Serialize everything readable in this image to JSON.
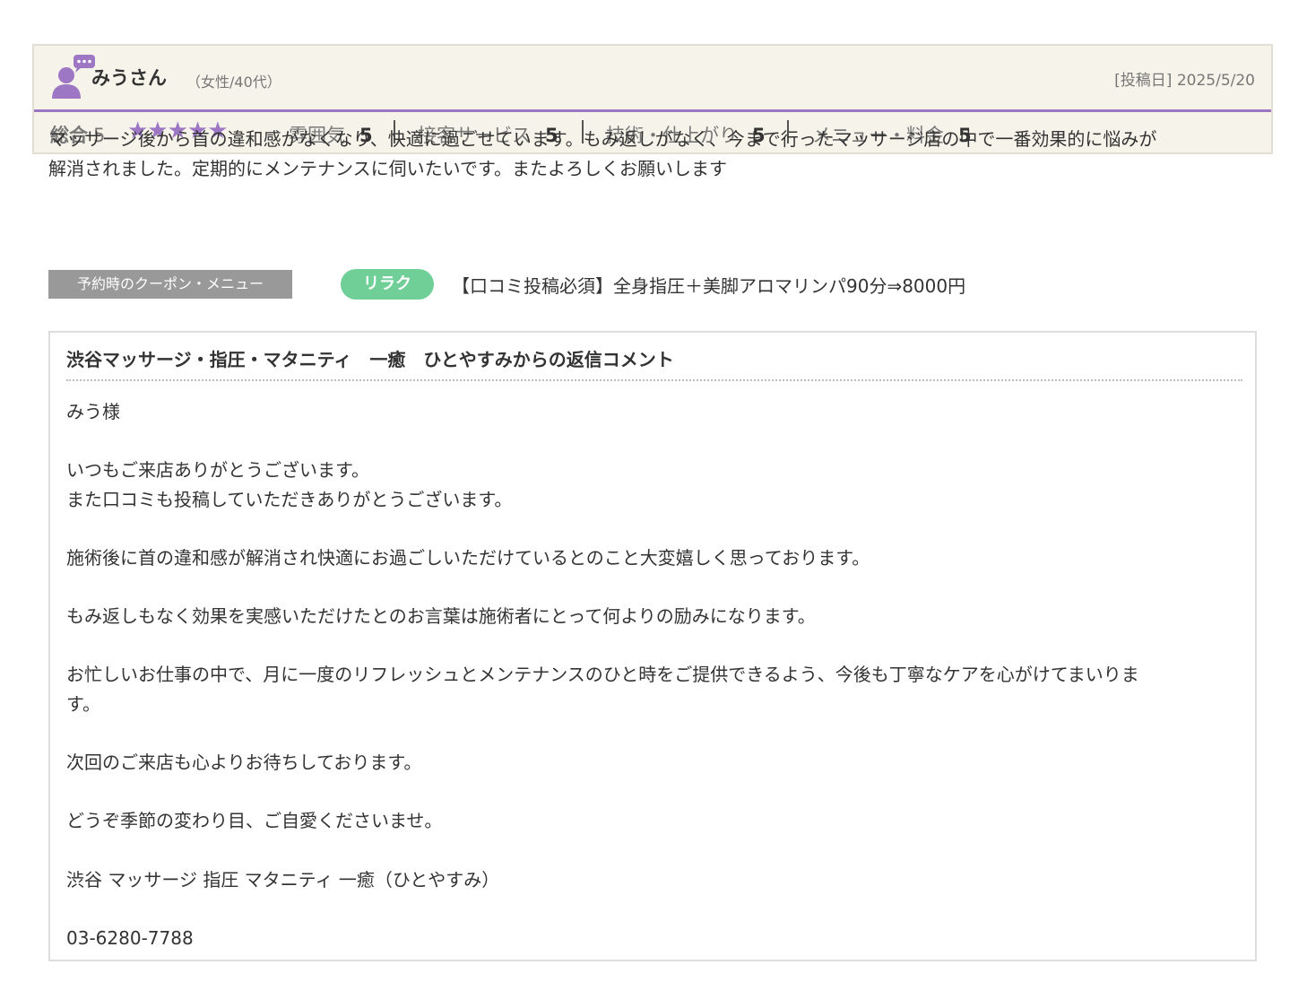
{
  "review": {
    "reviewer_name": "みうさん",
    "reviewer_attributes": "（女性/40代）",
    "post_date": "[投稿日] 2025/5/20",
    "overall_label": "総合",
    "overall_score": "5",
    "star_rating": 5,
    "stars_text": "★★★★★",
    "ratings": [
      {
        "label": "雰囲気",
        "value": "5"
      },
      {
        "label": "接客サービス",
        "value": "5"
      },
      {
        "label": "技術・仕上がり",
        "value": "5"
      },
      {
        "label": "メニュー・料金",
        "value": "5"
      }
    ],
    "comment_line1": "マッサージ後から首の違和感がなくなり、快適に過ごせています。もみ返しがなく、今まで行ったマッサージ店の中で一番効果的に悩みが",
    "comment_line2": "解消されました。定期的にメンテナンスに伺いたいです。またよろしくお願いします"
  },
  "coupon": {
    "label": "予約時のクーポン・メニュー",
    "badge": "リラク",
    "name": "【口コミ投稿必須】全身指圧＋美脚アロマリンパ90分⇒8000円"
  },
  "reply": {
    "title": "渋谷マッサージ・指圧・マタニティ　一癒　ひとやすみからの返信コメント",
    "greeting": "みう様",
    "p1_line1": "いつもご来店ありがとうございます。",
    "p1_line2": "また口コミも投稿していただきありがとうございます。",
    "p2": "施術後に首の違和感が解消され快適にお過ごしいただけているとのこと大変嬉しく思っております。",
    "p3": "もみ返しもなく効果を実感いただけたとのお言葉は施術者にとって何よりの励みになります。",
    "p4_line1": "お忙しいお仕事の中で、月に一度のリフレッシュとメンテナンスのひと時をご提供できるよう、今後も丁寧なケアを心がけてまいりま",
    "p4_line2": "す。",
    "p5": "次回のご来店も心よりお待ちしております。",
    "p6": "どうぞ季節の変わり目、ご自愛くださいませ。",
    "signature": "渋谷 マッサージ 指圧 マタニティ 一癒（ひとやすみ）",
    "phone": "03-6280-7788"
  },
  "colors": {
    "accent_purple": "#9d77c4",
    "badge_green": "#6fcf97",
    "header_bg": "#f6f3ea",
    "label_gray": "#999999"
  },
  "icons": {
    "reviewer_avatar": "user-comment-icon"
  }
}
